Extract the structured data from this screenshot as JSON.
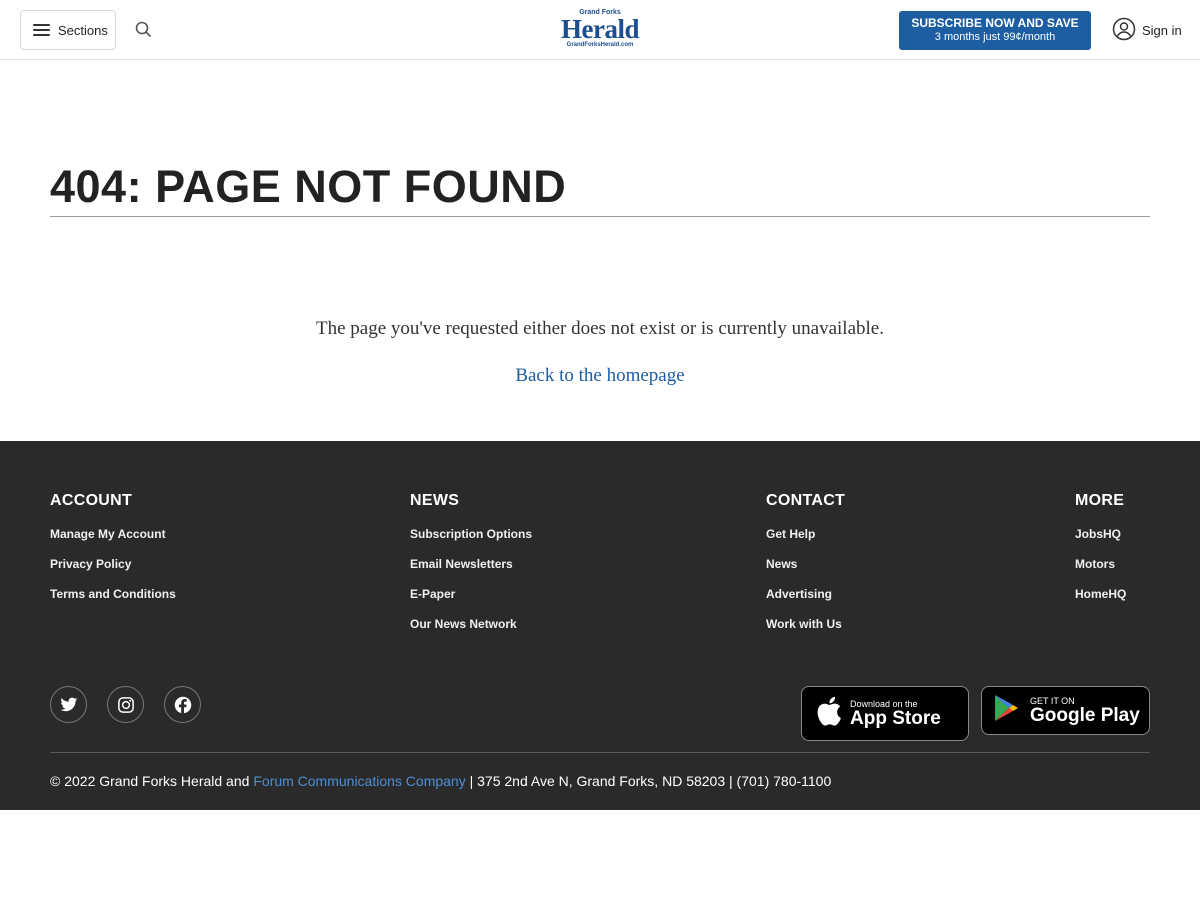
{
  "header": {
    "sections_label": "Sections",
    "logo_top": "Grand Forks",
    "logo_main": "Herald",
    "logo_sub": "GrandForksHerald.com",
    "subscribe_line1": "SUBSCRIBE NOW AND SAVE",
    "subscribe_line2": "3 months just 99¢/month",
    "signin_label": "Sign in"
  },
  "main": {
    "title": "404: PAGE NOT FOUND",
    "message": "The page you've requested either does not exist or is currently unavailable.",
    "home_link": "Back to the homepage"
  },
  "footer": {
    "columns": [
      {
        "heading": "ACCOUNT",
        "links": [
          "Manage My Account",
          "Privacy Policy",
          "Terms and Conditions"
        ]
      },
      {
        "heading": "NEWS",
        "links": [
          "Subscription Options",
          "Email Newsletters",
          "E-Paper",
          "Our News Network"
        ]
      },
      {
        "heading": "CONTACT",
        "links": [
          "Get Help",
          "News",
          "Advertising",
          "Work with Us"
        ]
      },
      {
        "heading": "MORE",
        "links": [
          "JobsHQ",
          "Motors",
          "HomeHQ"
        ]
      }
    ],
    "social_icons": [
      "twitter-icon",
      "instagram-icon",
      "facebook-icon"
    ],
    "app_store": {
      "line1": "Download on the",
      "line2": "App Store"
    },
    "google_play": {
      "line1": "GET IT ON",
      "line2": "Google Play"
    },
    "copyright_prefix": "© 2022 Grand Forks Herald and ",
    "copyright_link": "Forum Communications Company",
    "copyright_suffix": " | 375 2nd Ave N, Grand Forks, ND 58203 | (701) 780-1100"
  },
  "colors": {
    "accent": "#1d5ea3",
    "footer_bg": "#2a2a2a",
    "link_footer": "#4d8fd6"
  }
}
